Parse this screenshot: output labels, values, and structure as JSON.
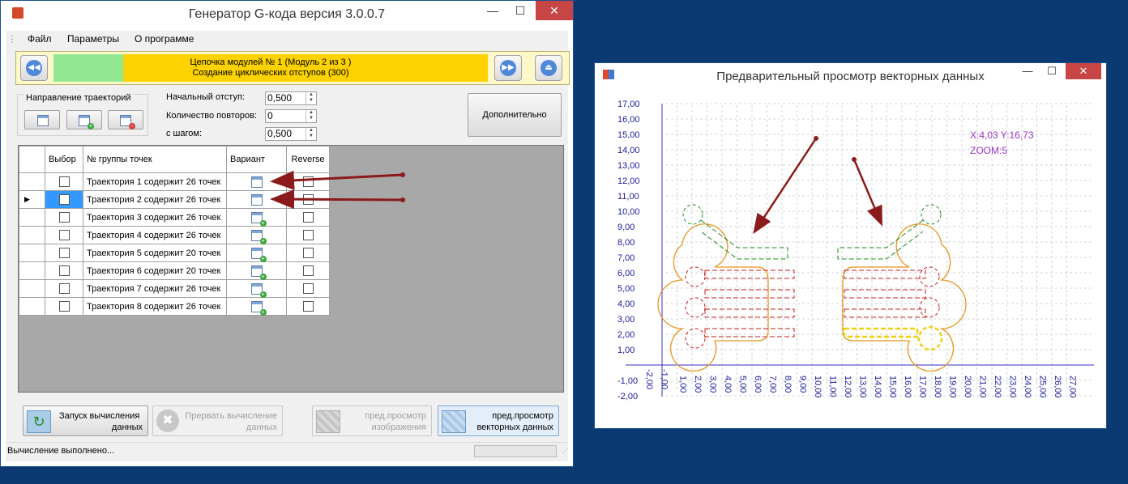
{
  "main_window": {
    "title": "Генератор G-кода версия 3.0.0.7",
    "menu": [
      "Файл",
      "Параметры",
      "О программе"
    ],
    "module_chain": {
      "line1": "Цепочка модулей № 1 (Модуль 2 из 3 )",
      "line2": "Создание циклических отступов (300)",
      "progress_fraction": 0.05
    },
    "direction_group_label": "Направление траекторий",
    "params": {
      "start_offset_label": "Начальный отступ:",
      "start_offset_value": "0,500",
      "repeat_count_label": "Количество повторов:",
      "repeat_count_value": "0",
      "step_label": "с шагом:",
      "step_value": "0,500"
    },
    "extra_button_label": "Дополнительно",
    "grid": {
      "columns": [
        "Выбор",
        "№ группы точек",
        "Вариант",
        "Reverse"
      ],
      "rows": [
        {
          "name": "Траектория 1 содержит 26 точек",
          "variant_icon": "calendar-icon",
          "selected": false
        },
        {
          "name": "Траектория 2 содержит 26 точек",
          "variant_icon": "calendar-icon",
          "selected": true
        },
        {
          "name": "Траектория 3 содержит 26 точек",
          "variant_icon": "calendar-add-icon",
          "selected": false
        },
        {
          "name": "Траектория 4 содержит 26 точек",
          "variant_icon": "calendar-add-icon",
          "selected": false
        },
        {
          "name": "Траектория 5 содержит 20 точек",
          "variant_icon": "calendar-add-icon",
          "selected": false
        },
        {
          "name": "Траектория 6 содержит 20 точек",
          "variant_icon": "calendar-add-icon",
          "selected": false
        },
        {
          "name": "Траектория 7 содержит 26 точек",
          "variant_icon": "calendar-add-icon",
          "selected": false
        },
        {
          "name": "Траектория 8 содержит 26 точек",
          "variant_icon": "calendar-add-icon",
          "selected": false
        }
      ]
    },
    "bottom_buttons": {
      "start_line1": "Запуск вычисления",
      "start_line2": "данных",
      "abort_line1": "Прервать вычисление",
      "abort_line2": "данных",
      "preview_image_line1": "пред.просмотр",
      "preview_image_line2": "изображения",
      "preview_vector_line1": "пред.просмотр",
      "preview_vector_line2": "векторных данных"
    },
    "status": "Вычисление выполнено..."
  },
  "preview_window": {
    "title": "Предварительный просмотр векторных данных",
    "coords": "X:4,03 Y:16,73",
    "zoom": "ZOOM:5",
    "y_ticks": [
      "17,00",
      "16,00",
      "15,00",
      "14,00",
      "13,00",
      "12,00",
      "11,00",
      "10,00",
      "9,00",
      "8,00",
      "7,00",
      "6,00",
      "5,00",
      "4,00",
      "3,00",
      "2,00",
      "1,00",
      "-1,00",
      "-2,00"
    ],
    "x_ticks": [
      "1,00",
      "2,00",
      "3,00",
      "4,00",
      "5,00",
      "6,00",
      "7,00",
      "8,00",
      "9,00",
      "10,00",
      "11,00",
      "12,00",
      "13,00",
      "14,00",
      "15,00",
      "16,00",
      "17,00",
      "18,00",
      "19,00",
      "20,00",
      "21,00",
      "22,00",
      "23,00",
      "24,00",
      "25,00",
      "26,00",
      "27,00"
    ],
    "x_neg_ticks": [
      "-1,00",
      "-2,00"
    ],
    "colors": {
      "outer": "#e8961e",
      "inner": "#c81e1e",
      "top": "#1e8c1e",
      "highlight": "#f0d010"
    }
  }
}
